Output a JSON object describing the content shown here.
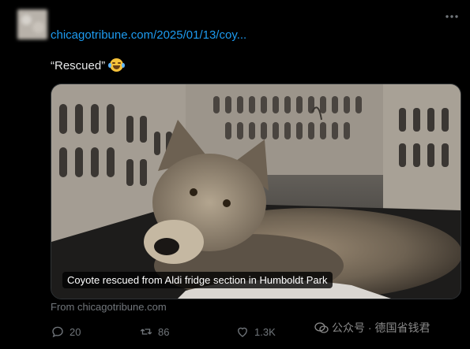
{
  "post": {
    "link_text": "chicagotribune.com/2025/01/13/coy...",
    "text": "“Rescued”",
    "emoji": "face-with-tears-of-joy"
  },
  "card": {
    "caption": "Coyote rescued from Aldi fridge section in Humboldt Park",
    "source": "From chicagotribune.com"
  },
  "actions": {
    "replies": "20",
    "reposts": "86",
    "likes": "1.3K"
  },
  "watermark": {
    "text": "公众号 · 德国省钱君"
  },
  "colors": {
    "accent": "#1d9bf0",
    "muted": "#71767b",
    "text": "#e7e9ea",
    "background": "#000000"
  }
}
